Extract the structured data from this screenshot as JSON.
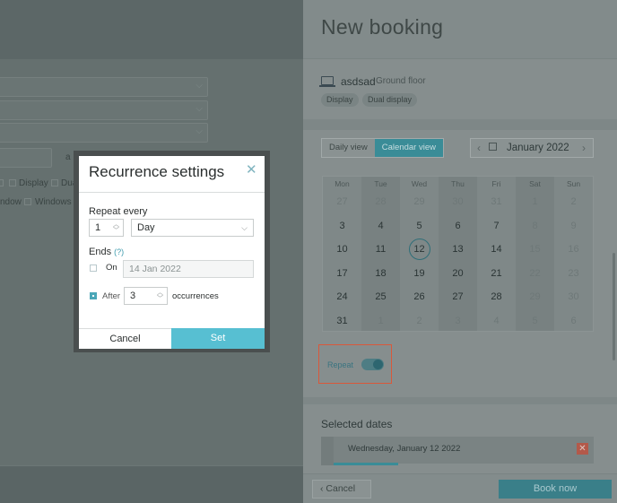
{
  "background": {
    "partial_text_1": "a",
    "checkbox_labels": [
      "Display",
      "Dual"
    ],
    "checkbox_labels_2": [
      "ndow",
      "Windows"
    ]
  },
  "panel": {
    "title": "New booking",
    "resource": {
      "icon": "laptop-icon",
      "name": "asdsad",
      "floor": "Ground floor"
    },
    "tags": [
      "Display",
      "Dual display"
    ],
    "views": {
      "daily": "Daily view",
      "calendar": "Calendar view",
      "active": "calendar"
    },
    "month_nav": {
      "prev": "‹",
      "next": "›",
      "month": "January 2022"
    },
    "calendar": {
      "weekdays": [
        "Mon",
        "Tue",
        "Wed",
        "Thu",
        "Fri",
        "Sat",
        "Sun"
      ],
      "weeks": [
        [
          "27",
          "28",
          "29",
          "30",
          "31",
          "1",
          "2"
        ],
        [
          "3",
          "4",
          "5",
          "6",
          "7",
          "8",
          "9"
        ],
        [
          "10",
          "11",
          "12",
          "13",
          "14",
          "15",
          "16"
        ],
        [
          "17",
          "18",
          "19",
          "20",
          "21",
          "22",
          "23"
        ],
        [
          "24",
          "25",
          "26",
          "27",
          "28",
          "29",
          "30"
        ],
        [
          "31",
          "1",
          "2",
          "3",
          "4",
          "5",
          "6"
        ]
      ],
      "selected": "12"
    },
    "repeat": {
      "label": "Repeat",
      "on": true
    },
    "selected_dates": {
      "title": "Selected dates",
      "items": [
        "Wednesday, January 12 2022"
      ],
      "delete_glyph": "✕"
    },
    "footer": {
      "cancel": "‹ Cancel",
      "book": "Book now"
    }
  },
  "modal": {
    "title": "Recurrence settings",
    "close_glyph": "✕",
    "repeat_every_label": "Repeat every",
    "repeat_count": "1",
    "repeat_unit": "Day",
    "ends_label": "Ends",
    "ends_help": "(?)",
    "on_label": "On",
    "on_date": "14 Jan 2022",
    "on_checked": false,
    "after_label": "After",
    "after_count": "3",
    "after_checked": true,
    "occurrences_label": "occurrences",
    "cancel": "Cancel",
    "set": "Set"
  }
}
